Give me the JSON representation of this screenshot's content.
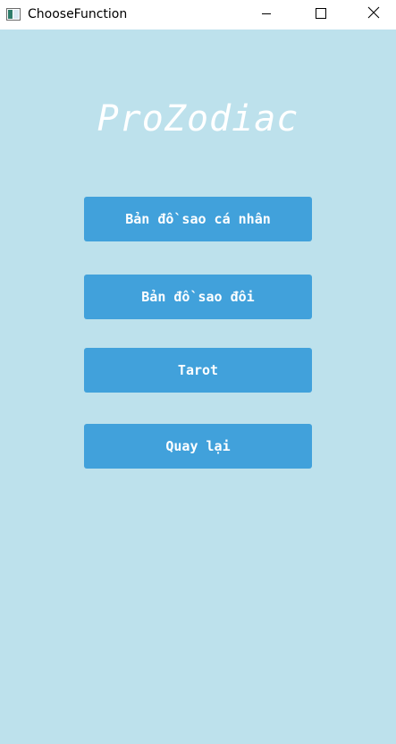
{
  "window": {
    "title": "ChooseFunction",
    "background_color": "#bde1ec",
    "titlebar_color": "#ffffff",
    "controls": {
      "minimize_icon": "minimize-icon",
      "maximize_icon": "maximize-icon",
      "close_icon": "close-icon"
    }
  },
  "main": {
    "logo_text": "ProZodiac",
    "button_color": "#41a1db",
    "buttons": [
      {
        "label": "Bản đồ sao cá nhân"
      },
      {
        "label": "Bản đồ sao đôi"
      },
      {
        "label": "Tarot"
      },
      {
        "label": "Quay lại"
      }
    ]
  }
}
